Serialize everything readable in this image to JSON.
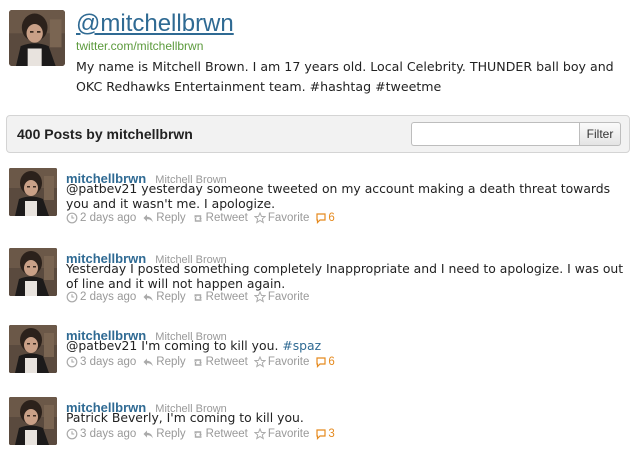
{
  "profile": {
    "handle": "@mitchellbrwn",
    "url": "twitter.com/mitchellbrwn",
    "bio": "My name is Mitchell Brown. I am 17 years old. Local Celebrity. THUNDER ball boy and OKC Redhawks Entertainment team. #hashtag #tweetme"
  },
  "toolbar": {
    "title": "400 Posts by mitchellbrwn",
    "filter_placeholder": "",
    "filter_label": "Filter"
  },
  "actions": {
    "reply": "Reply",
    "retweet": "Retweet",
    "favorite": "Favorite"
  },
  "tweets": [
    {
      "username": "mitchellbrwn",
      "realname": "Mitchell Brown",
      "text": "@patbev21 yesterday someone tweeted on my account making a death threat towards you and it wasn't me. I apologize.",
      "hashtag": "",
      "time": "2 days ago",
      "count": "6"
    },
    {
      "username": "mitchellbrwn",
      "realname": "Mitchell Brown",
      "text": "Yesterday I posted something completely Inappropriate and I need to apologize. I was out of line and it will not happen again.",
      "hashtag": "",
      "time": "2 days ago",
      "count": ""
    },
    {
      "username": "mitchellbrwn",
      "realname": "Mitchell Brown",
      "text": "@patbev21 I'm coming to kill you.",
      "hashtag": "#spaz",
      "time": "3 days ago",
      "count": "6"
    },
    {
      "username": "mitchellbrwn",
      "realname": "Mitchell Brown",
      "text": "Patrick Beverly, I'm coming to kill you.",
      "hashtag": "",
      "time": "3 days ago",
      "count": "3"
    }
  ]
}
